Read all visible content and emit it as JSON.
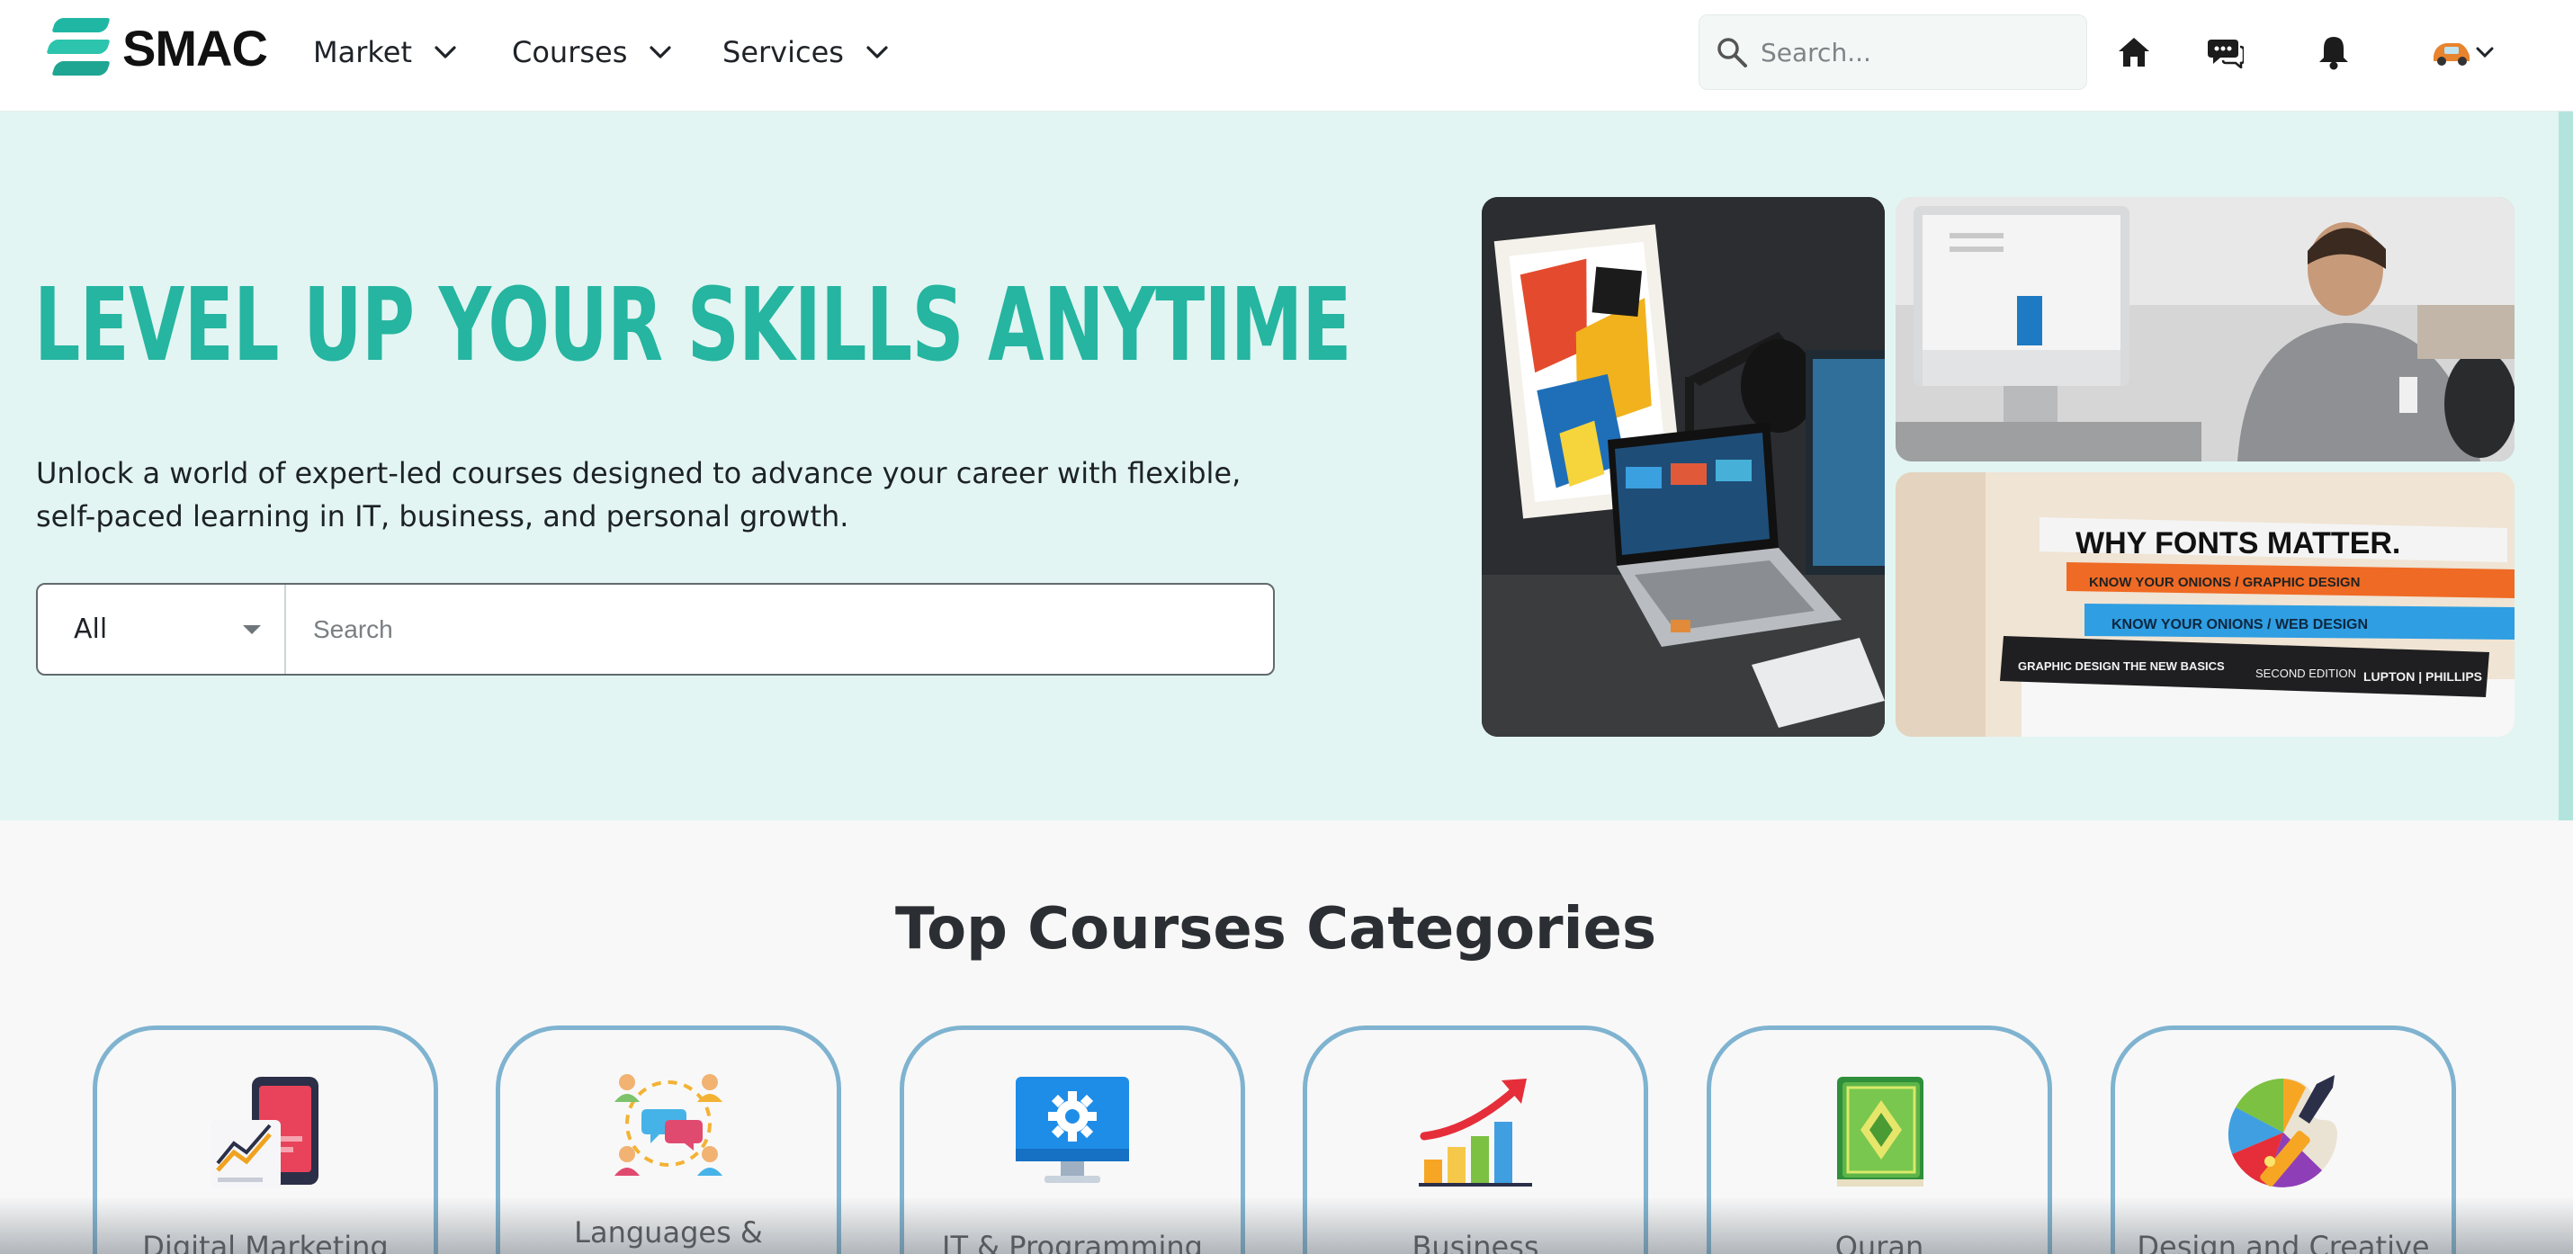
{
  "brand": {
    "name": "SMAC"
  },
  "nav": {
    "items": [
      {
        "label": "Market"
      },
      {
        "label": "Courses"
      },
      {
        "label": "Services"
      }
    ],
    "search_placeholder": "Search..."
  },
  "hero": {
    "title": "LEVEL UP YOUR SKILLS ANYTIME",
    "subtitle": "Unlock a world of expert-led courses designed to advance your career with flexible, self-paced learning in IT, business, and personal growth.",
    "search": {
      "category": "All",
      "placeholder": "Search"
    },
    "photo_3_text": {
      "line1": "WHY FONTS MATTER.",
      "line2": "KNOW YOUR ONIONS / GRAPHIC DESIGN",
      "line3": "KNOW YOUR ONIONS / WEB DESIGN",
      "line4": "GRAPHIC DESIGN THE NEW BASICS",
      "line4b": "SECOND EDITION",
      "line4c": "LUPTON | PHILLIPS"
    }
  },
  "categories": {
    "title": "Top Courses Categories",
    "items": [
      {
        "label": "Digital Marketing",
        "icon": "digital-marketing-icon"
      },
      {
        "label": "Languages &",
        "icon": "languages-icon"
      },
      {
        "label": "IT & Programming",
        "icon": "it-programming-icon"
      },
      {
        "label": "Business",
        "icon": "business-icon"
      },
      {
        "label": "Quran",
        "icon": "quran-icon"
      },
      {
        "label": "Design and Creative",
        "icon": "design-creative-icon"
      }
    ]
  },
  "colors": {
    "accent": "#25b5a0",
    "hero_bg": "#e2f5f2",
    "card_border": "#7fb3d0"
  }
}
